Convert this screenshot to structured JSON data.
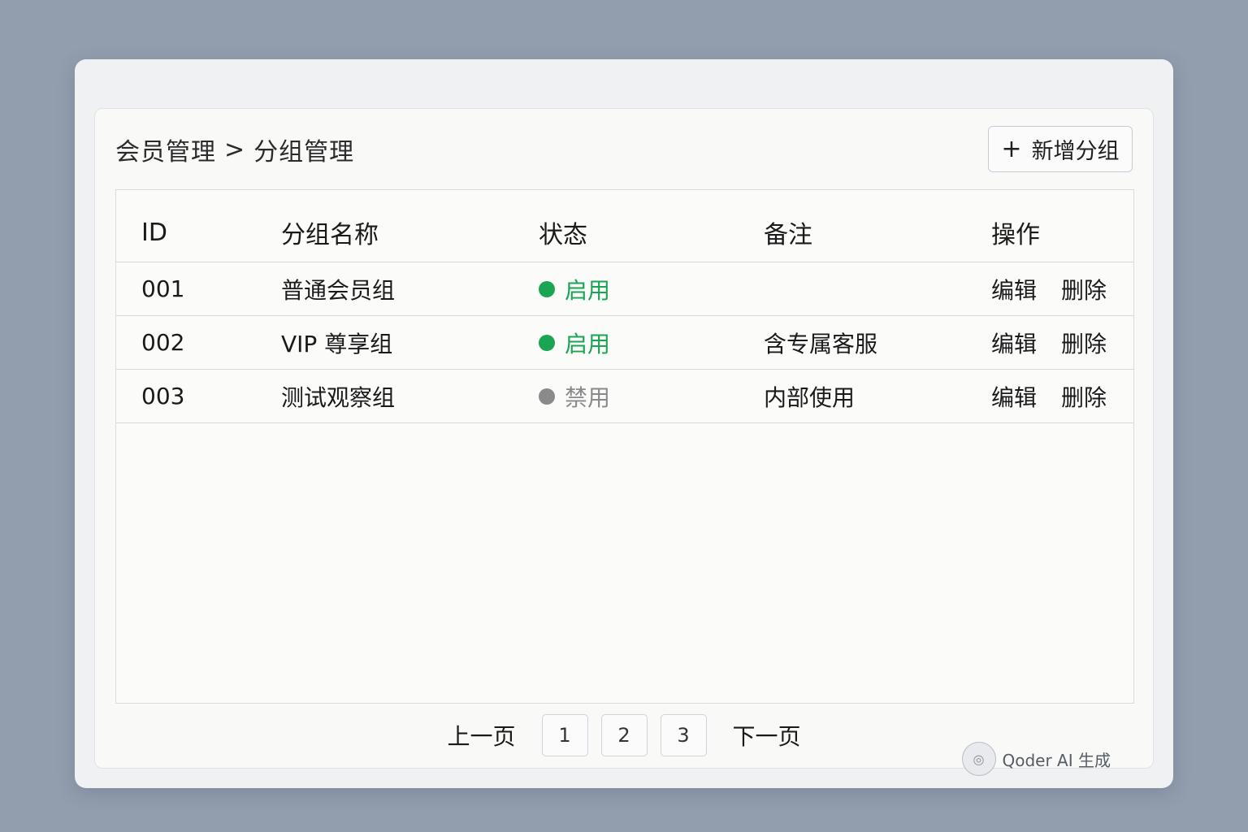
{
  "breadcrumb": {
    "parent": "会员管理",
    "separator": ">",
    "current": "分组管理"
  },
  "toolbar": {
    "add_icon": "plus-icon",
    "add_label": "新增分组"
  },
  "table": {
    "columns": [
      "ID",
      "分组名称",
      "状态",
      "备注",
      "操作"
    ],
    "rows": [
      {
        "id": "001",
        "name": "普通会员组",
        "status": "启用",
        "remark": "",
        "edit": "编辑",
        "delete": "删除"
      },
      {
        "id": "002",
        "name": "VIP 尊享组",
        "status": "启用",
        "remark": "含专属客服",
        "edit": "编辑",
        "delete": "删除"
      },
      {
        "id": "003",
        "name": "测试观察组",
        "status": "禁用",
        "remark": "内部使用",
        "edit": "编辑",
        "delete": "删除"
      }
    ]
  },
  "colors": {
    "enabled": "#1aa553",
    "disabled": "#8a8a8a"
  },
  "pagination": {
    "prev": "上一页",
    "pages": [
      "1",
      "2",
      "3"
    ],
    "next": "下一页"
  },
  "watermark": {
    "text": "Qoder AI 生成",
    "icon": "qoder-logo-icon"
  }
}
